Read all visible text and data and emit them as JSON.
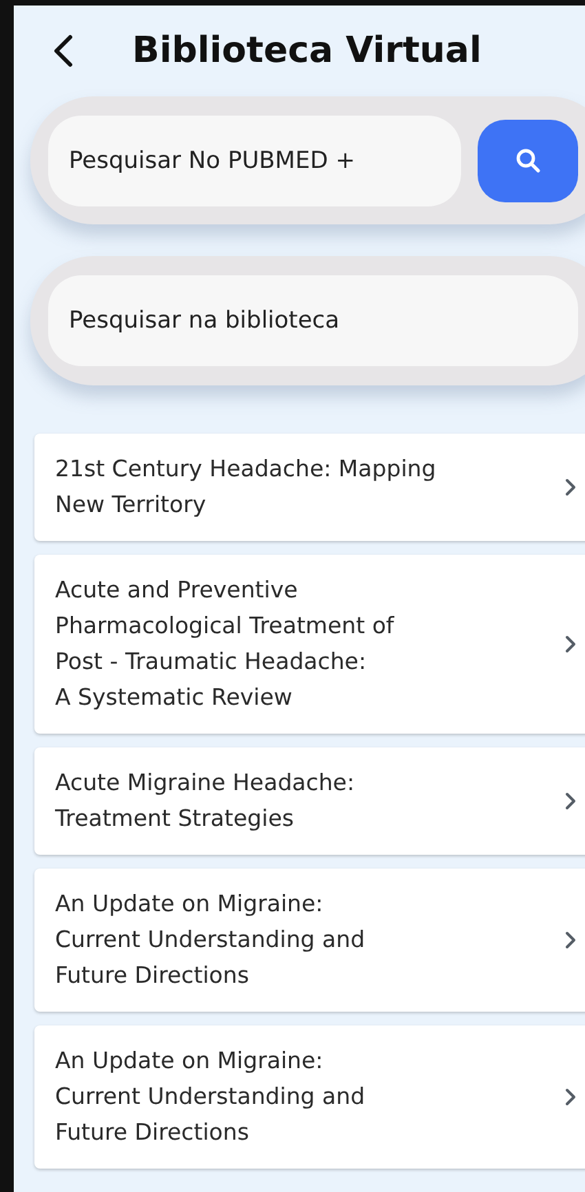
{
  "header": {
    "title": "Biblioteca Virtual"
  },
  "pubmed_search": {
    "placeholder": "Pesquisar No PUBMED +"
  },
  "library_search": {
    "placeholder": "Pesquisar na biblioteca"
  },
  "articles": [
    {
      "title": "21st Century Headache: Mapping\nNew Territory"
    },
    {
      "title": "Acute and Preventive\nPharmacological Treatment of\nPost - Traumatic Headache:\nA Systematic Review"
    },
    {
      "title": "Acute Migraine Headache:\nTreatment Strategies"
    },
    {
      "title": "An Update on Migraine:\nCurrent Understanding and\nFuture Directions"
    },
    {
      "title": "An Update on Migraine:\nCurrent Understanding and\nFuture Directions"
    }
  ]
}
